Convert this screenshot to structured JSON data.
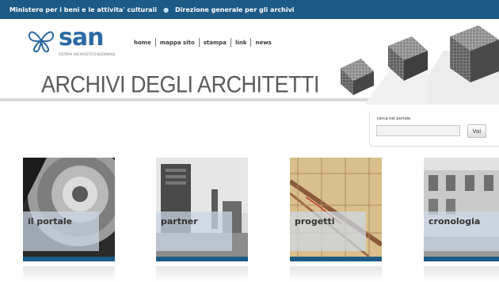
{
  "topbar": {
    "link1": "Ministero per i beni e le attivita' culturali",
    "separator": "●",
    "link2": "Direzione generale per gli archivi"
  },
  "logo": {
    "wordmark": "san",
    "tagline": "SISTEMA ARCHIVISTICO NAZIONALE"
  },
  "nav": {
    "items": [
      "home",
      "mappa sito",
      "stampa",
      "link",
      "news"
    ]
  },
  "site_title": "ARCHIVI DEGLI ARCHITETTI",
  "search": {
    "label": "cerca nel portale",
    "value": "",
    "placeholder": "",
    "button": "Vai"
  },
  "tiles": [
    {
      "label": "il portale"
    },
    {
      "label": "partner"
    },
    {
      "label": "progetti"
    },
    {
      "label": "cronologia"
    }
  ],
  "colors": {
    "topbar": "#1d5a86",
    "brand_blue": "#2c6aa3",
    "title_gray": "#5b5b5b"
  }
}
